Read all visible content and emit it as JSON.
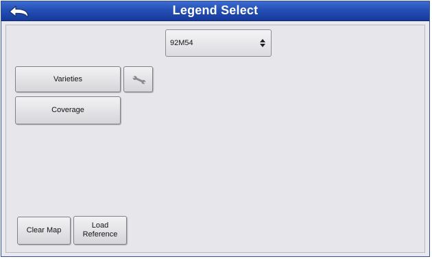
{
  "window": {
    "title": "Legend Select"
  },
  "icons": {
    "back": "back-arrow-icon",
    "wrench": "wrench-icon",
    "select_arrows": "up-down-arrows-icon"
  },
  "legend_select": {
    "selected_value": "92M54"
  },
  "legend_buttons": {
    "varieties_label": "Varieties",
    "coverage_label": "Coverage"
  },
  "footer_buttons": {
    "clear_map_label": "Clear Map",
    "load_reference_line1": "Load",
    "load_reference_line2": "Reference"
  },
  "colors": {
    "titlebar": "#2450b6",
    "background": "#e6e6eb"
  }
}
